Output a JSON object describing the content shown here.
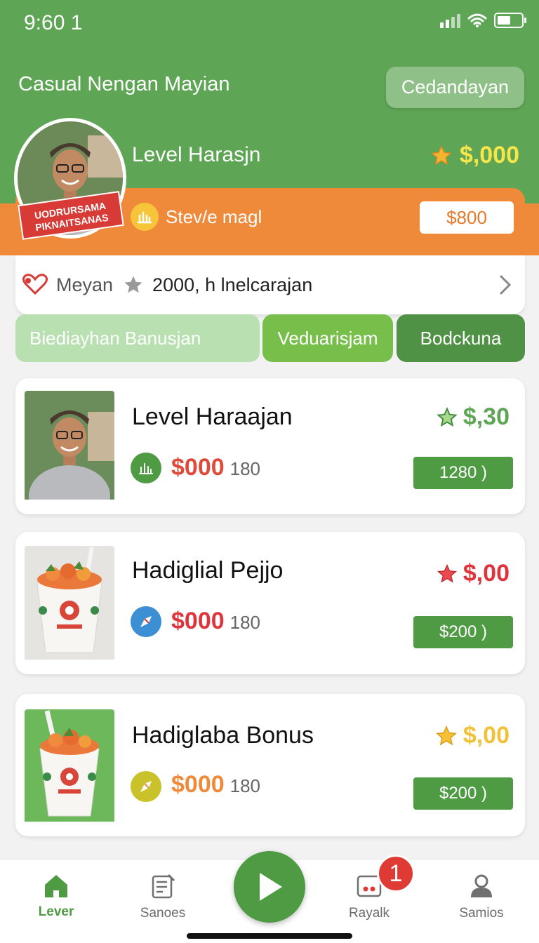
{
  "status_bar": {
    "time": "9:60 1"
  },
  "header": {
    "title": "Casual Nengan Mayian",
    "action_button": "Cedandayan",
    "profile": {
      "badge_text": "UODRURSAMA PIKNAITSANAS",
      "level_name": "Level Harasjn",
      "score": "$,000"
    },
    "strip": {
      "text": "Stev/e magl",
      "button": "$800"
    }
  },
  "info": {
    "label": "Meyan",
    "stat": "2000, h lnelcarajan"
  },
  "tabs": [
    {
      "label": "Biediayhan Banusjan"
    },
    {
      "label": "Veduarisjam"
    },
    {
      "label": "Bodckuna"
    }
  ],
  "cards": [
    {
      "title": "Level Haraajan",
      "score": "$,30",
      "price": "$000",
      "qty": "180",
      "button": "1280 )",
      "score_color": "#5ea555",
      "price_color": "#e04a3a"
    },
    {
      "title": "Hadiglial Pejjo",
      "score": "$,00",
      "price": "$000",
      "qty": "180",
      "button": "$200 )",
      "score_color": "#e0343c",
      "price_color": "#e0343c"
    },
    {
      "title": "Hadiglaba Bonus",
      "score": "$,00",
      "price": "$000",
      "qty": "180",
      "button": "$200 )",
      "score_color": "#f0c23a",
      "price_color": "#ee8a3a"
    }
  ],
  "nav": [
    {
      "label": "Lever",
      "icon": "home-icon"
    },
    {
      "label": "Sanoes",
      "icon": "scores-icon"
    },
    {
      "label": "Rayalk",
      "icon": "rewards-icon",
      "badge": "1"
    },
    {
      "label": "Samios",
      "icon": "account-icon"
    }
  ],
  "colors": {
    "primary_green": "#5ea555",
    "accent_orange": "#ee8a3a",
    "badge_red": "#e03a35"
  }
}
